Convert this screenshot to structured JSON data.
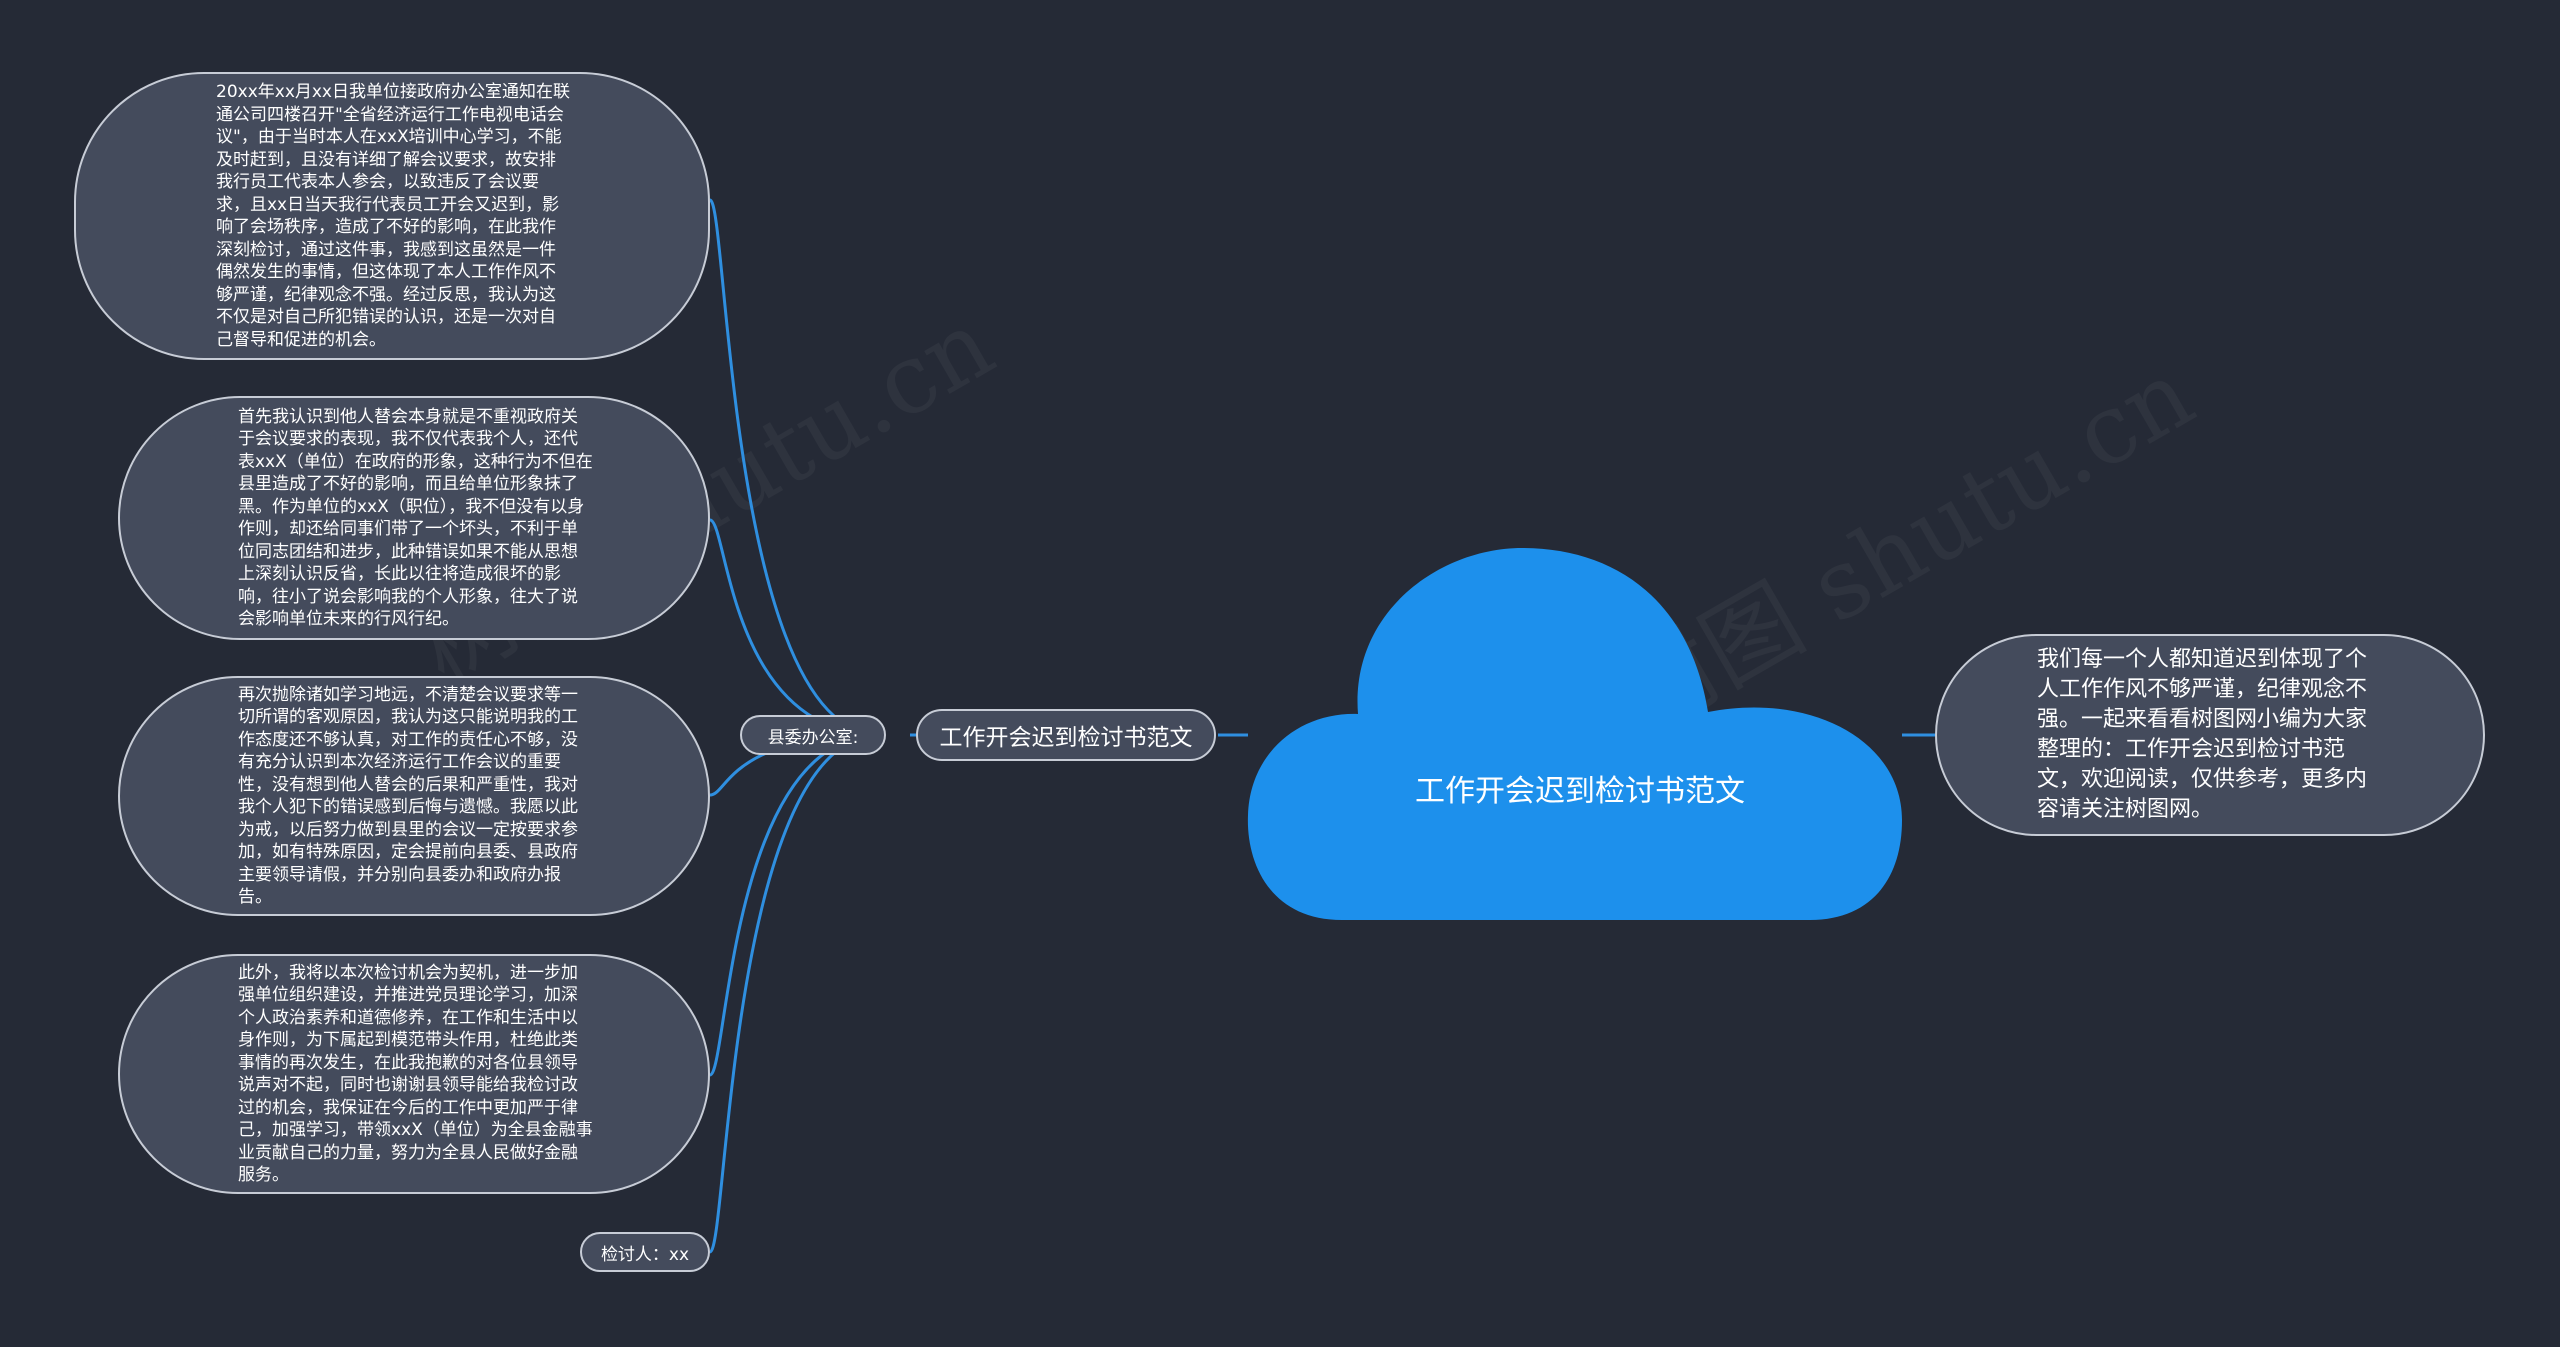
{
  "watermark": "树图 shutu.cn",
  "central": {
    "title": "工作开会迟到检讨书范文"
  },
  "right_description": "我们每一个人都知道迟到体现了个人工作作风不够严谨，纪律观念不强。一起来看看树图网小编为大家整理的：工作开会迟到检讨书范文，欢迎阅读，仅供参考，更多内容请关注树图网。",
  "branch": {
    "label": "工作开会迟到检讨书范文"
  },
  "sub_branch": {
    "label": "县委办公室:"
  },
  "leaves": [
    "20xx年xx月xx日我单位接政府办公室通知在联通公司四楼召开\"全省经济运行工作电视电话会议\"，由于当时本人在xxX培训中心学习，不能及时赶到，且没有详细了解会议要求，故安排我行员工代表本人参会，以致违反了会议要求，且xx日当天我行代表员工开会又迟到，影响了会场秩序，造成了不好的影响，在此我作深刻检讨，通过这件事，我感到这虽然是一件偶然发生的事情，但这体现了本人工作作风不够严谨，纪律观念不强。经过反思，我认为这不仅是对自己所犯错误的认识，还是一次对自己督导和促进的机会。",
    "首先我认识到他人替会本身就是不重视政府关于会议要求的表现，我不仅代表我个人，还代表xxX（单位）在政府的形象，这种行为不但在县里造成了不好的影响，而且给单位形象抹了黑。作为单位的xxX（职位），我不但没有以身作则，却还给同事们带了一个坏头，不利于单位同志团结和进步，此种错误如果不能从思想上深刻认识反省，长此以往将造成很坏的影响，往小了说会影响我的个人形象，往大了说会影响单位未来的行风行纪。",
    "再次抛除诸如学习地远，不清楚会议要求等一切所谓的客观原因，我认为这只能说明我的工作态度还不够认真，对工作的责任心不够，没有充分认识到本次经济运行工作会议的重要性，没有想到他人替会的后果和严重性，我对我个人犯下的错误感到后悔与遗憾。我愿以此为戒，以后努力做到县里的会议一定按要求参加，如有特殊原因，定会提前向县委、县政府主要领导请假，并分别向县委办和政府办报告。",
    "此外，我将以本次检讨机会为契机，进一步加强单位组织建设，并推进党员理论学习，加深个人政治素养和道德修养，在工作和生活中以身作则，为下属起到模范带头作用，杜绝此类事情的再次发生，在此我抱歉的对各位县领导说声对不起，同时也谢谢县领导能给我检讨改过的机会，我保证在今后的工作中更加严于律己，加强学习，带领xxX（单位）为全县金融事业贡献自己的力量，努力为全县人民做好金融服务。"
  ],
  "signature": "检讨人：xx",
  "colors": {
    "background": "#252a36",
    "cloud": "#1d90ec",
    "node_fill": "#444b5c",
    "node_border": "#c7ccd6",
    "connector": "#2f8fe0"
  }
}
